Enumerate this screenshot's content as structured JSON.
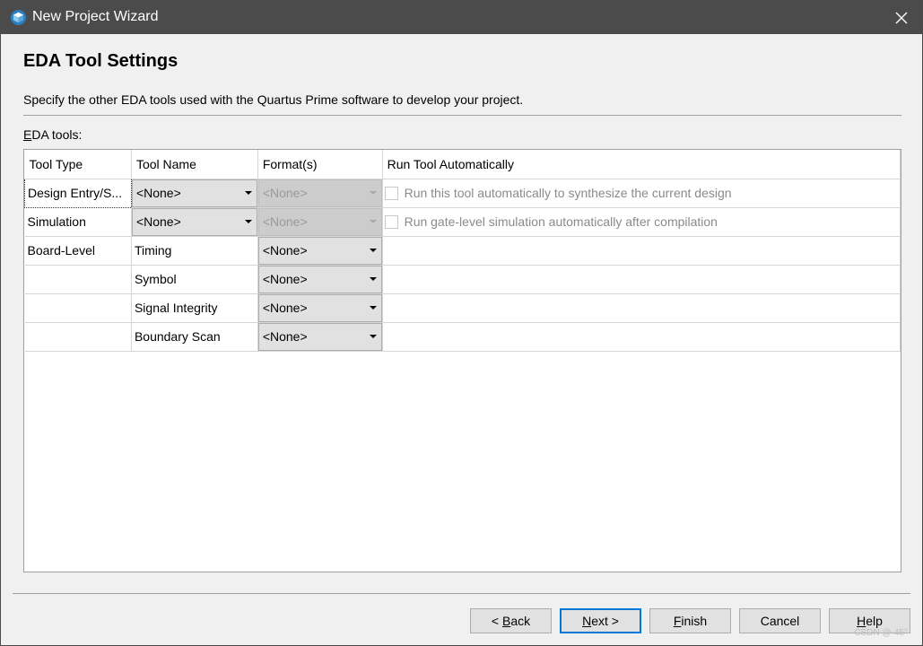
{
  "window": {
    "title": "New Project Wizard",
    "icon": "quartus-logo-icon",
    "close_icon": "close-icon"
  },
  "page": {
    "header": "EDA Tool Settings",
    "description": "Specify the other EDA tools used with the Quartus Prime software to develop your project.",
    "section_label_mnemonic": "E",
    "section_label_rest": "DA tools:"
  },
  "table": {
    "columns": [
      "Tool Type",
      "Tool Name",
      "Format(s)",
      "Run Tool Automatically"
    ],
    "rows": [
      {
        "tool_type": "Design Entry/S...",
        "tool_name": "<None>",
        "formats": "<None>",
        "formats_enabled": false,
        "run_auto": "Run this tool automatically to synthesize the current design"
      },
      {
        "tool_type": "Simulation",
        "tool_name": "<None>",
        "formats": "<None>",
        "formats_enabled": false,
        "run_auto": "Run gate-level simulation automatically after compilation"
      },
      {
        "tool_type": "Board-Level",
        "tool_name": "Timing",
        "formats": "<None>"
      },
      {
        "tool_type": "",
        "tool_name": "Symbol",
        "formats": "<None>"
      },
      {
        "tool_type": "",
        "tool_name": "Signal Integrity",
        "formats": "<None>"
      },
      {
        "tool_type": "",
        "tool_name": "Boundary Scan",
        "formats": "<None>"
      }
    ]
  },
  "buttons": {
    "back": {
      "prefix": "< ",
      "mnemonic": "B",
      "rest": "ack"
    },
    "next": {
      "mnemonic": "N",
      "rest": "ext >"
    },
    "finish": {
      "mnemonic": "F",
      "rest": "inish"
    },
    "cancel": {
      "label": "Cancel"
    },
    "help": {
      "mnemonic": "H",
      "rest": "elp"
    }
  },
  "watermark": "CSDN @-45°",
  "colors": {
    "titlebar": "#4b4b4b",
    "default_button_border": "#0078d7",
    "disabled_combo": "#cccccc"
  }
}
